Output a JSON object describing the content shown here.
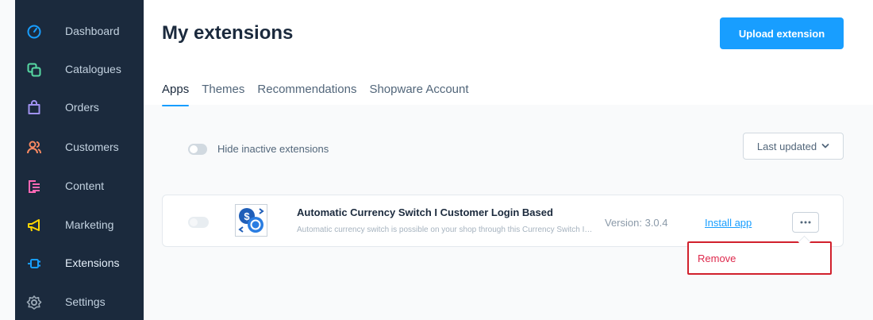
{
  "sidebar": {
    "items": [
      {
        "label": "Dashboard",
        "icon": "dashboard-icon",
        "color": "#189eff"
      },
      {
        "label": "Catalogues",
        "icon": "catalogue-icon",
        "color": "#57d9a3"
      },
      {
        "label": "Orders",
        "icon": "orders-icon",
        "color": "#a092f0"
      },
      {
        "label": "Customers",
        "icon": "customers-icon",
        "color": "#f88962"
      },
      {
        "label": "Content",
        "icon": "content-icon",
        "color": "#ff68b4"
      },
      {
        "label": "Marketing",
        "icon": "marketing-icon",
        "color": "#ffd700"
      },
      {
        "label": "Extensions",
        "icon": "extensions-icon",
        "color": "#189eff"
      },
      {
        "label": "Settings",
        "icon": "settings-icon",
        "color": "#9aa8b5"
      }
    ]
  },
  "header": {
    "title": "My extensions",
    "upload_label": "Upload extension",
    "tabs": [
      {
        "label": "Apps",
        "active": true
      },
      {
        "label": "Themes",
        "active": false
      },
      {
        "label": "Recommendations",
        "active": false
      },
      {
        "label": "Shopware Account",
        "active": false
      }
    ]
  },
  "filters": {
    "hide_inactive_label": "Hide inactive extensions",
    "sort_label": "Last updated"
  },
  "extension": {
    "name": "Automatic Currency Switch I Customer Login Based",
    "description": "Automatic currency switch is possible on your shop through this Currency Switch I Customer Login Based",
    "version": "Version: 3.0.4",
    "install_label": "Install app"
  },
  "context_menu": {
    "remove_label": "Remove"
  },
  "colors": {
    "accent": "#189eff",
    "sidebar_bg": "#1b2a3d",
    "danger": "#de294c",
    "highlight_border": "#d1202c"
  }
}
